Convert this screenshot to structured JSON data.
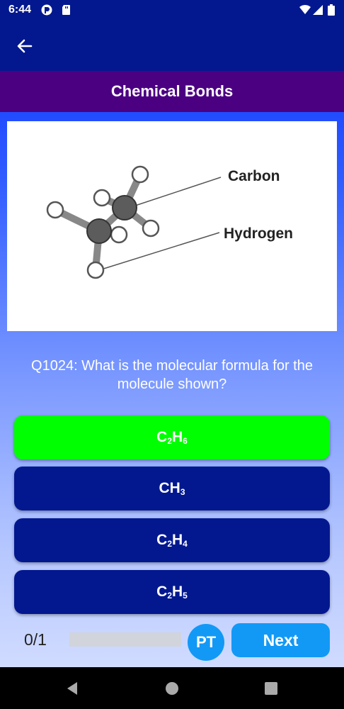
{
  "status_bar": {
    "time": "6:44"
  },
  "header": {
    "title": "Chemical Bonds"
  },
  "figure": {
    "label_carbon": "Carbon",
    "label_hydrogen": "Hydrogen"
  },
  "question": {
    "text": "Q1024: What is the molecular formula for the molecule shown?"
  },
  "answers": [
    {
      "parts": [
        [
          "C",
          "2"
        ],
        [
          "H",
          "6"
        ]
      ],
      "state": "correct",
      "color": "#00ff00"
    },
    {
      "parts": [
        [
          "CH",
          "3"
        ]
      ],
      "state": "default",
      "color": "#03188f"
    },
    {
      "parts": [
        [
          "C",
          "2"
        ],
        [
          "H",
          "4"
        ]
      ],
      "state": "default",
      "color": "#03188f"
    },
    {
      "parts": [
        [
          "C",
          "2"
        ],
        [
          "H",
          "5"
        ]
      ],
      "state": "default",
      "color": "#03188f"
    }
  ],
  "footer": {
    "score": "0/1",
    "progress_fraction": 0,
    "pt_label": "PT",
    "next_label": "Next"
  },
  "colors": {
    "primary": "#03188f",
    "header_purple": "#4b0082",
    "accent_blue": "#1299f6",
    "correct_green": "#00ff00"
  }
}
